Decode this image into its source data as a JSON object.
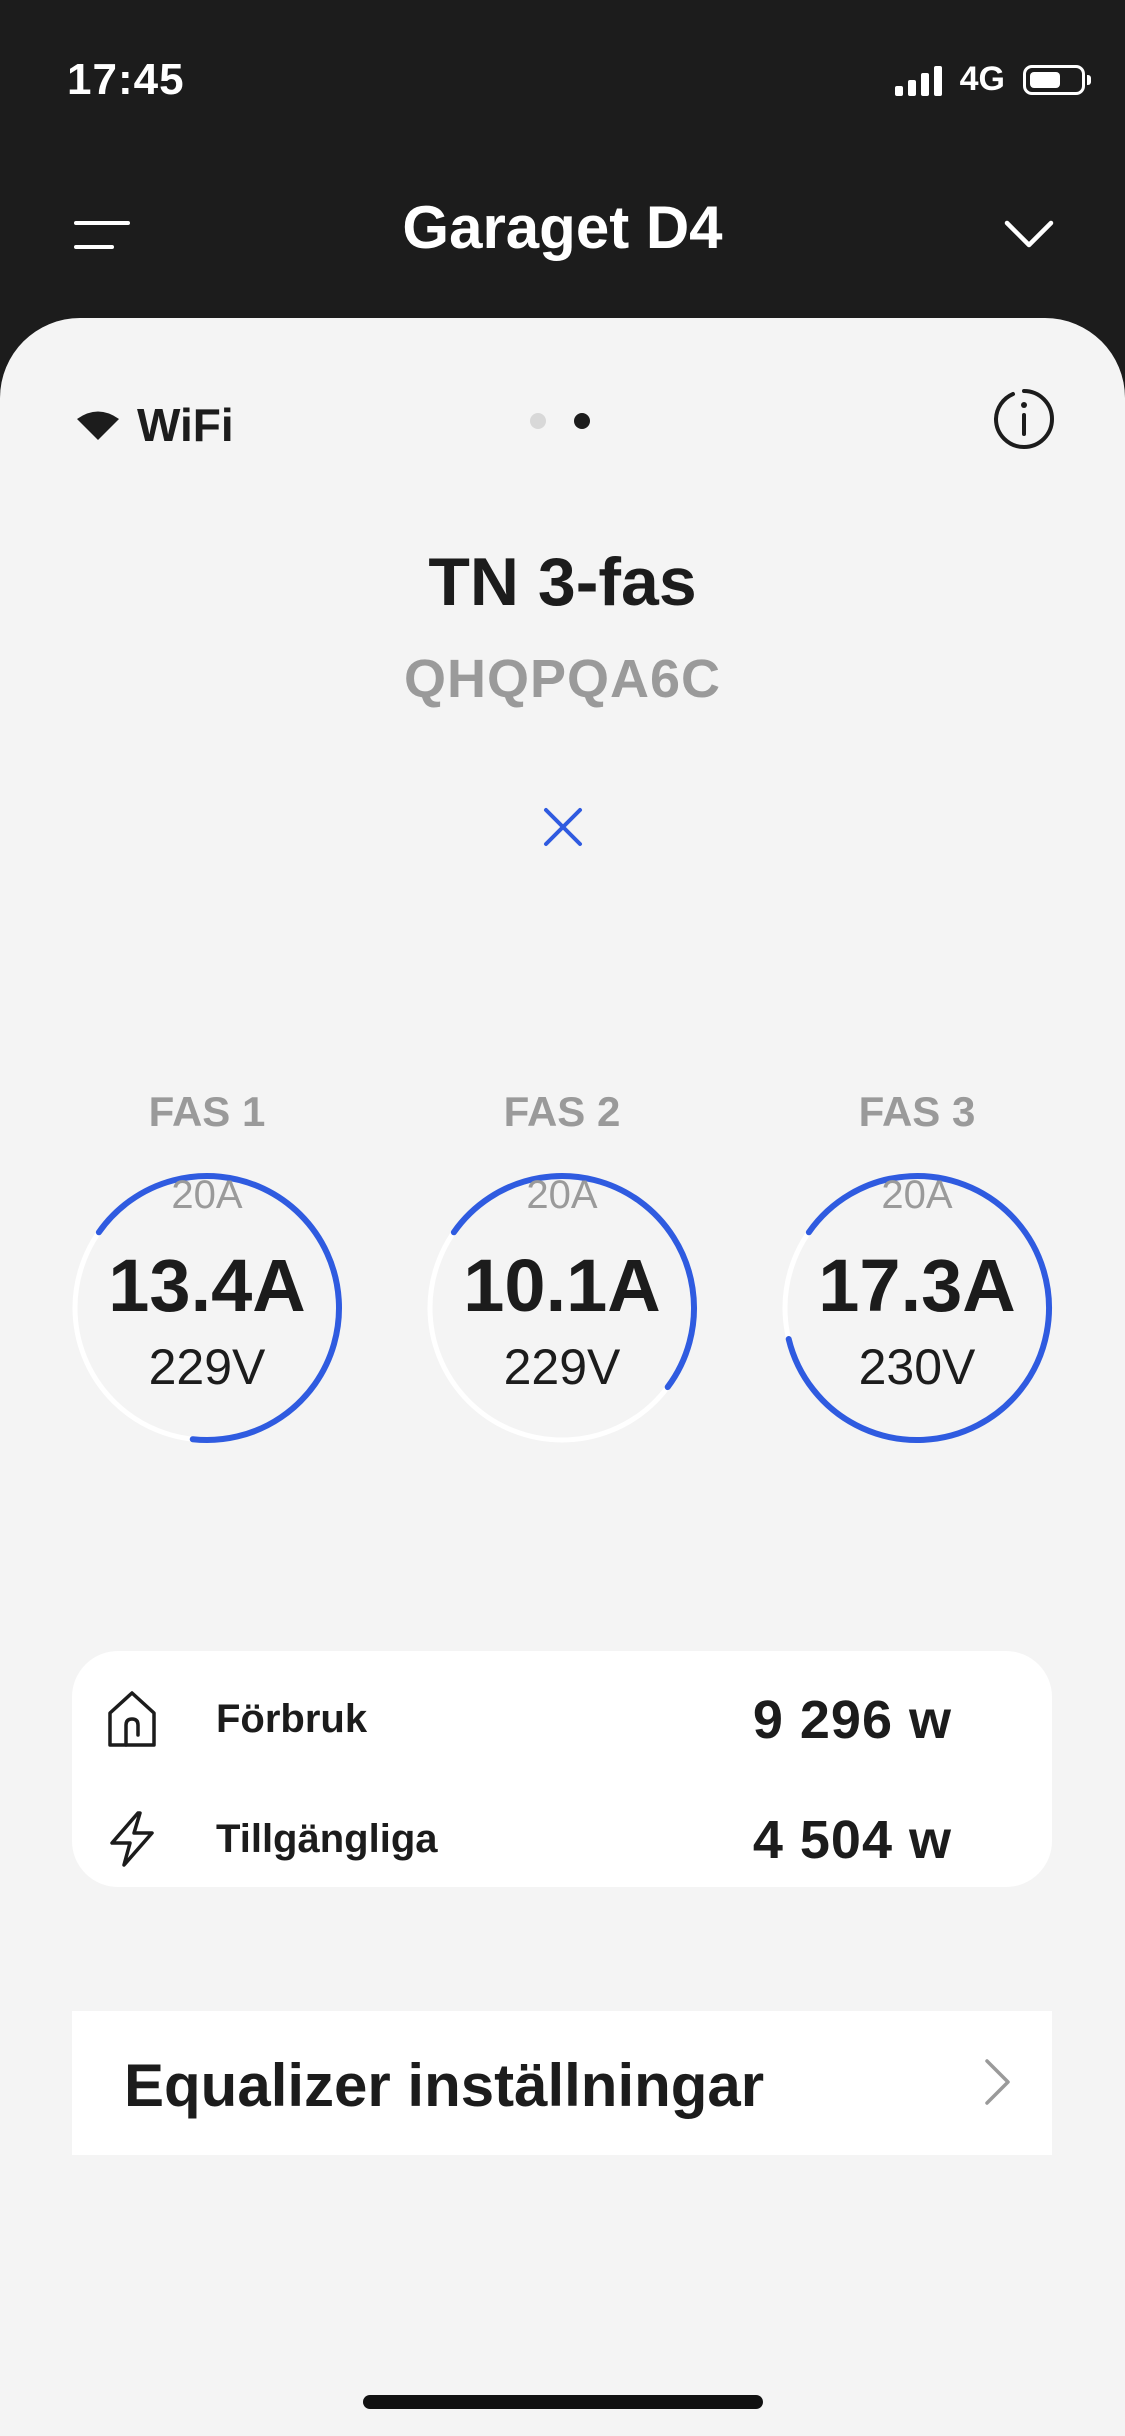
{
  "status_bar": {
    "time": "17:45",
    "network": "4G"
  },
  "header": {
    "title": "Garaget D4"
  },
  "connection": {
    "label": "WiFi"
  },
  "pager": {
    "count": 2,
    "active_index": 1
  },
  "device": {
    "type": "TN 3-fas",
    "id": "QHQPQA6C"
  },
  "phases": [
    {
      "label": "FAS 1",
      "max": "20A",
      "current": "13.4A",
      "voltage": "229V",
      "fraction": 0.67
    },
    {
      "label": "FAS 2",
      "max": "20A",
      "current": "10.1A",
      "voltage": "229V",
      "fraction": 0.505
    },
    {
      "label": "FAS 3",
      "max": "20A",
      "current": "17.3A",
      "voltage": "230V",
      "fraction": 0.865
    }
  ],
  "stats": {
    "consumption": {
      "label": "Förbruk",
      "value": "9 296 w"
    },
    "available": {
      "label": "Tillgängliga",
      "value": "4 504 w"
    }
  },
  "equalizer": {
    "label": "Equalizer inställningar"
  },
  "colors": {
    "accent": "#2f5be0",
    "dark": "#1c1c1c",
    "muted": "#9a9a9a",
    "background": "#f4f4f4"
  }
}
